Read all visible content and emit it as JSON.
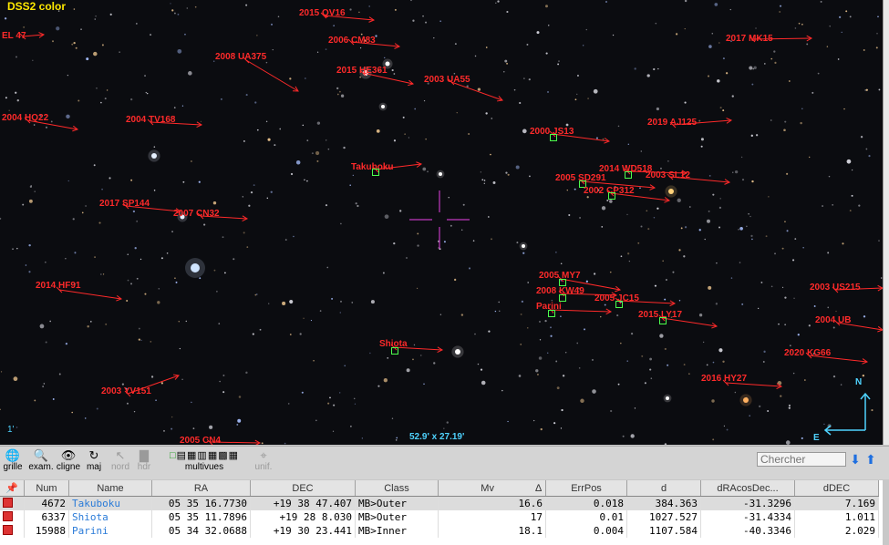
{
  "sky": {
    "survey": "DSS2 color",
    "scale": "1'",
    "fov": "52.9' x 27.19'",
    "compass": {
      "north": "N",
      "east": "E"
    },
    "objects": [
      {
        "name": "2015 QV16"
      },
      {
        "name": "EL 47"
      },
      {
        "name": "2006 CM83"
      },
      {
        "name": "2017 MK15"
      },
      {
        "name": "2008 UA375"
      },
      {
        "name": "2015 HE361"
      },
      {
        "name": "2003 UA55"
      },
      {
        "name": "2004 HQ22"
      },
      {
        "name": "2004 TV168"
      },
      {
        "name": "2019 AJ125"
      },
      {
        "name": "2000 JS13"
      },
      {
        "name": "Takuboku"
      },
      {
        "name": "2014 WD518"
      },
      {
        "name": "2003 SL12"
      },
      {
        "name": "2005 SD291"
      },
      {
        "name": "2002 CP312"
      },
      {
        "name": "2017 SP144"
      },
      {
        "name": "2007 CN32"
      },
      {
        "name": "2005 MY7"
      },
      {
        "name": "2014 HF91"
      },
      {
        "name": "2008 KW49"
      },
      {
        "name": "2005 JC15"
      },
      {
        "name": "2003 US215"
      },
      {
        "name": "Parini"
      },
      {
        "name": "2015 LY17"
      },
      {
        "name": "2004 UB"
      },
      {
        "name": "Shiota"
      },
      {
        "name": "2020 KG66"
      },
      {
        "name": "2016 HY27"
      },
      {
        "name": "2003 YV151"
      },
      {
        "name": "2005 CN4"
      }
    ]
  },
  "toolbar": {
    "tools": [
      {
        "label": "grille",
        "icon": "globe-icon"
      },
      {
        "label": "exam.",
        "icon": "magnifier-icon"
      },
      {
        "label": "cligne",
        "icon": "eye-icon"
      },
      {
        "label": "maj",
        "icon": "refresh-icon"
      },
      {
        "label": "nord",
        "icon": "north-arrow-icon"
      },
      {
        "label": "hdr",
        "icon": "histogram-icon"
      },
      {
        "label": "multivues",
        "icon": "multiview-icon"
      },
      {
        "label": "unif.",
        "icon": "crosshair-icon"
      }
    ],
    "search_placeholder": "Chercher"
  },
  "table": {
    "columns": [
      "Num",
      "Name",
      "RA",
      "DEC",
      "Class",
      "Mv",
      "ErrPos",
      "d",
      "dRAcosDec...",
      "dDEC"
    ],
    "sort_marker": "∆",
    "rows": [
      {
        "num": "4672",
        "name": "Takuboku",
        "ra": "05 35 16.7730",
        "dec": "+19 38 47.407",
        "class": "MB>Outer",
        "mv": "16.6",
        "errpos": "0.018",
        "d": "384.363",
        "dra": "-31.3296",
        "ddec": "7.169"
      },
      {
        "num": "6337",
        "name": "Shiota",
        "ra": "05 35 11.7896",
        "dec": "+19 28 8.030",
        "class": "MB>Outer",
        "mv": "17",
        "errpos": "0.01",
        "d": "1027.527",
        "dra": "-31.4334",
        "ddec": "1.011"
      },
      {
        "num": "15988",
        "name": "Parini",
        "ra": "05 34 32.0688",
        "dec": "+19 30 23.441",
        "class": "MB>Inner",
        "mv": "18.1",
        "errpos": "0.004",
        "d": "1107.584",
        "dra": "-40.3346",
        "ddec": "2.029"
      }
    ]
  },
  "colors": {
    "label": "#ff2a2a",
    "marker": "#4cff4c",
    "info": "#4fd3ff",
    "survey": "#ffe800",
    "reticle": "#c03ac0"
  }
}
